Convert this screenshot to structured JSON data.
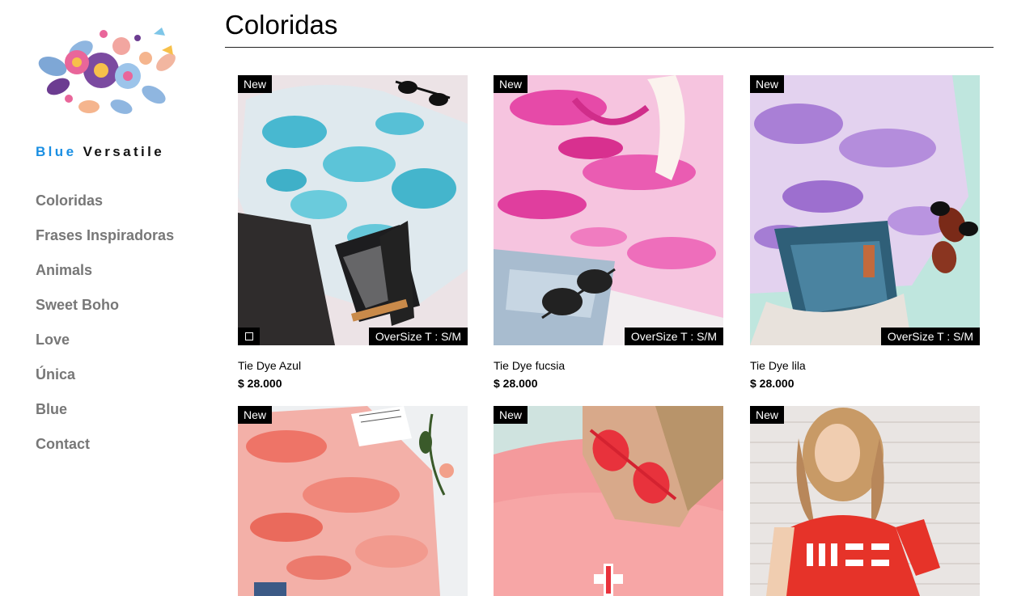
{
  "brand": {
    "part1": "Blue",
    "part2": "Versatile"
  },
  "nav": [
    "Coloridas",
    "Frases Inspiradoras",
    "Animals",
    "Sweet Boho",
    "Love",
    "Única",
    "Blue",
    "Contact"
  ],
  "page_title": "Coloridas",
  "products": [
    {
      "name": "Tie Dye Azul",
      "price": "$ 28.000",
      "badge": "New",
      "size_tag": "OverSize T : S/M"
    },
    {
      "name": "Tie Dye fucsia",
      "price": "$ 28.000",
      "badge": "New",
      "size_tag": "OverSize T : S/M"
    },
    {
      "name": "Tie Dye lila",
      "price": "$ 28.000",
      "badge": "New",
      "size_tag": "OverSize T : S/M"
    },
    {
      "badge": "New"
    },
    {
      "badge": "New"
    },
    {
      "badge": "New"
    }
  ],
  "colors": {
    "brand_blue": "#1a8fe3",
    "nav_text": "#777777",
    "tag_bg": "#000000"
  }
}
